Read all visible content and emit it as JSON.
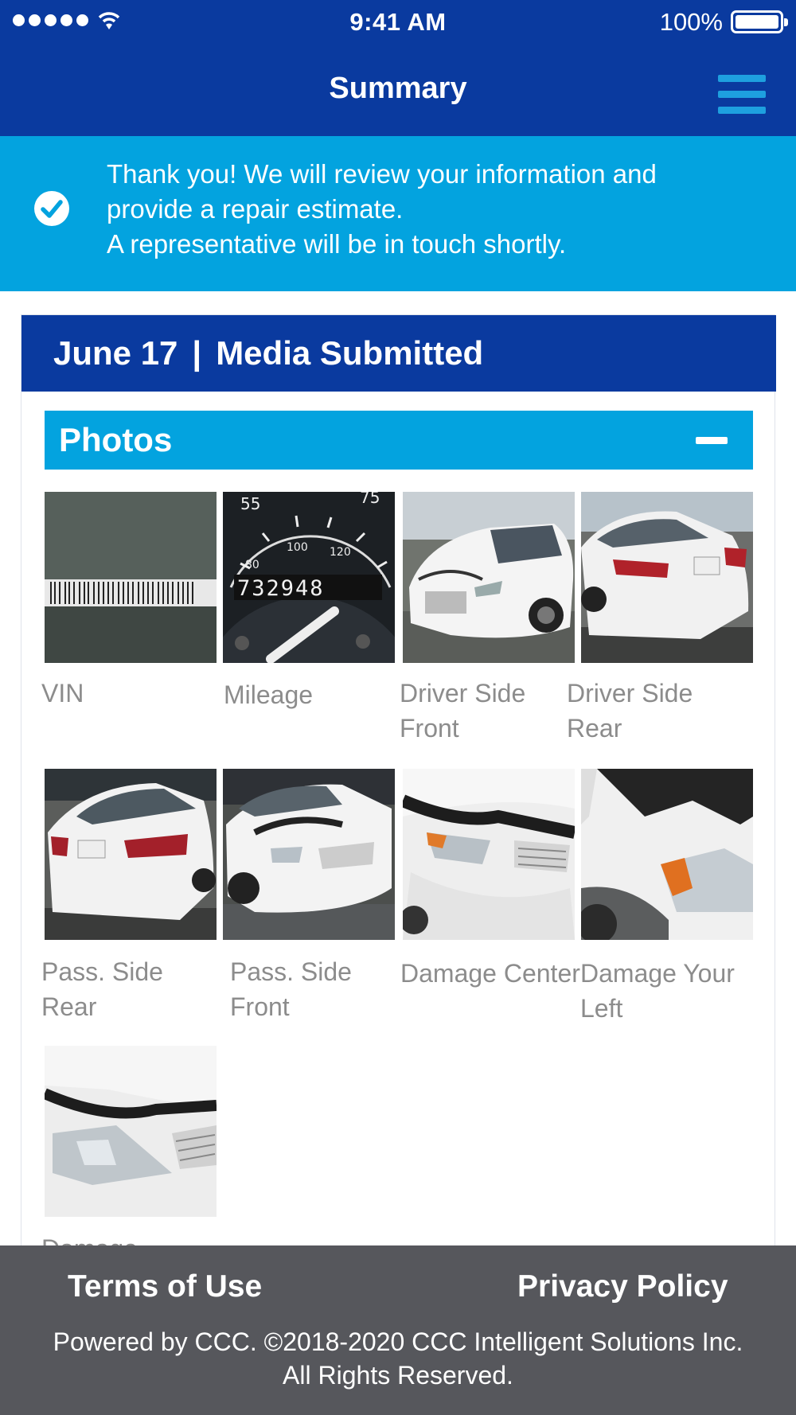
{
  "status_bar": {
    "time": "9:41 AM",
    "battery": "100%"
  },
  "header": {
    "title": "Summary",
    "menu_icon": "hamburger-menu-icon"
  },
  "banner": {
    "icon": "check-circle-icon",
    "line1": "Thank you! We will review your information and",
    "line2": "provide a repair estimate.",
    "line3": "A representative will be in touch shortly."
  },
  "card": {
    "date": "June 17",
    "separator": "|",
    "title": "Media Submitted"
  },
  "photos_section": {
    "title": "Photos",
    "toggle_icon": "minus-icon",
    "items": [
      {
        "label": "VIN"
      },
      {
        "label": "Mileage"
      },
      {
        "label": "Driver Side Front"
      },
      {
        "label": "Driver Side Rear"
      },
      {
        "label": "Pass. Side Rear"
      },
      {
        "label": "Pass. Side Front"
      },
      {
        "label": "Damage Center"
      },
      {
        "label": "Damage Your Left"
      },
      {
        "label": "Damage"
      }
    ],
    "odometer_reading": "732948",
    "speedometer_ticks": [
      "55",
      "75",
      "80",
      "100",
      "120"
    ]
  },
  "footer": {
    "terms": "Terms of Use",
    "privacy": "Privacy Policy",
    "copyright_line1": "Powered by CCC. ©2018-2020 CCC Intelligent Solutions Inc.",
    "copyright_line2": "All Rights Reserved."
  },
  "colors": {
    "nav_blue": "#0a3a9f",
    "accent_cyan": "#03a3df",
    "menu_icon": "#1ea0df",
    "footer_gray": "#56575c",
    "label_gray": "#8c8c8c"
  }
}
